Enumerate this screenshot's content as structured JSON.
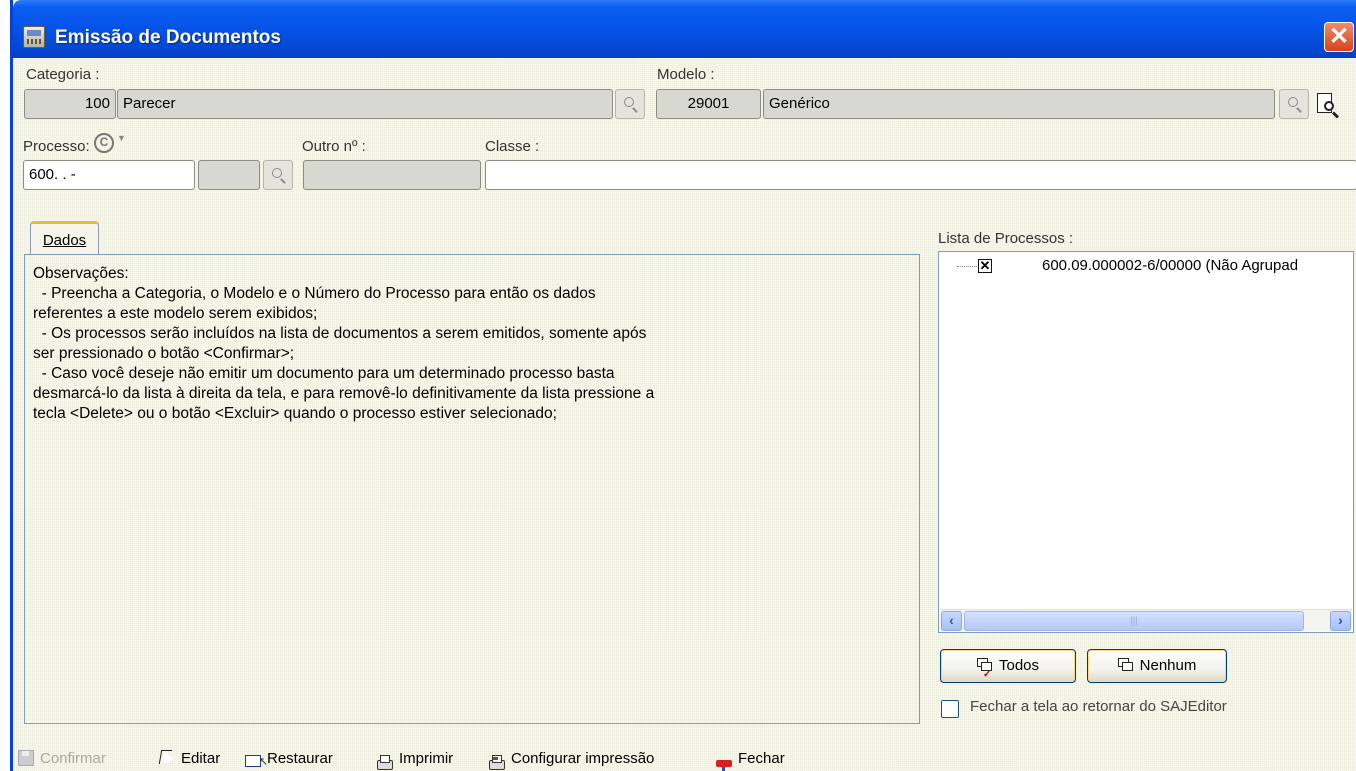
{
  "window": {
    "title": "Emissão de Documentos",
    "close_label": "✕"
  },
  "categoria": {
    "label": "Categoria :",
    "code": "100",
    "name": "Parecer"
  },
  "modelo": {
    "label": "Modelo :",
    "code": "29001",
    "name": "Genérico"
  },
  "processo": {
    "label": "Processo:",
    "value": "600.   .       -",
    "refresh_icon_glyph": "C"
  },
  "outro": {
    "label": "Outro nº :"
  },
  "classe": {
    "label": "Classe :",
    "value": ""
  },
  "tab": {
    "label": "Dados"
  },
  "observacoes": {
    "lines": [
      "Observações:",
      "  - Preencha a Categoria, o Modelo e o Número do Processo para então os dados",
      "referentes a este modelo serem exibidos;",
      "  - Os processos serão incluídos na lista de documentos a serem emitidos, somente após",
      "ser pressionado o botão <Confirmar>;",
      "  - Caso você deseje não emitir um documento para um determinado processo basta",
      "desmarcá-lo da lista à direita da tela, e para removê-lo definitivamente da lista pressione a",
      "tecla <Delete> ou o botão <Excluir> quando o processo estiver selecionado;"
    ]
  },
  "lista": {
    "label": "Lista de Processos :",
    "items": [
      {
        "text": "600.09.000002-6/00000 (Não Agrupad",
        "checked": true
      }
    ]
  },
  "buttons": {
    "todos": "Todos",
    "nenhum": "Nenhum"
  },
  "fechar_check": {
    "label": "Fechar a tela ao retornar do SAJEditor",
    "checked": false
  },
  "toolbar": {
    "confirmar": "Confirmar",
    "editar": "Editar",
    "restaurar": "Restaurar",
    "imprimir": "Imprimir",
    "configurar": "Configurar impressão",
    "fechar": "Fechar"
  },
  "colors": {
    "titlebar": "#0553e6",
    "window_bg": "#efefd8",
    "panel_border": "#7f9db9"
  }
}
